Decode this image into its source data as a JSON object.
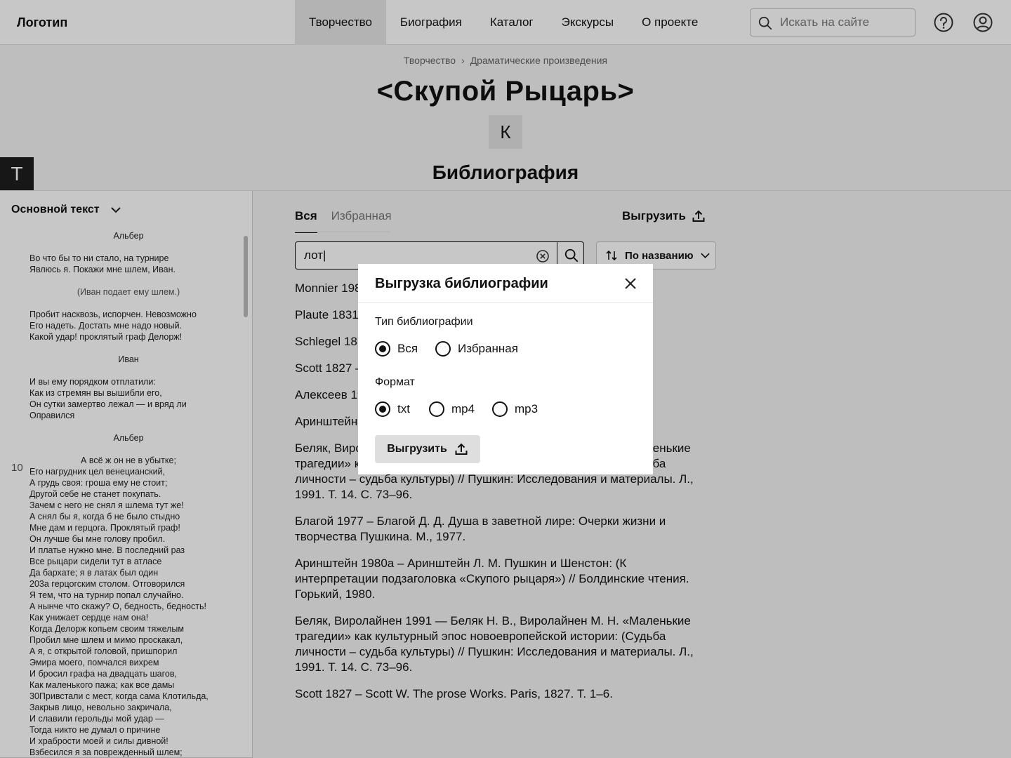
{
  "header": {
    "logo": "Логотип",
    "nav": [
      "Творчество",
      "Биография",
      "Каталог",
      "Экскурсы",
      "О проекте"
    ],
    "active_nav": "Творчество",
    "search_placeholder": "Искать на сайте"
  },
  "breadcrumb": [
    "Творчество",
    "Драматические произведения"
  ],
  "page_title": "<Скупой Рыцарь>",
  "letter_button": "К",
  "text_button": "Т",
  "section_title": "Библиография",
  "text_panel": {
    "title": "Основной текст",
    "line_number": "10",
    "blocks": [
      {
        "type": "speaker",
        "text": "Альбер"
      },
      {
        "type": "verse",
        "lines": [
          "Во что бы то ни стало, на турнире",
          "Явлюсь я. Покажи мне шлем, Иван."
        ]
      },
      {
        "type": "stage",
        "text": "(Иван подает ему шлем.)"
      },
      {
        "type": "verse",
        "lines": [
          "Пробит насквозь, испорчен. Невозможно",
          "Его надеть. Достать мне надо новый.",
          "Какой удар! проклятый граф Делорж!"
        ]
      },
      {
        "type": "speaker",
        "text": "Иван"
      },
      {
        "type": "verse",
        "lines": [
          "И вы ему порядком отплатили:",
          "Как из стремян вы вышибли его,",
          "Он сутки замертво лежал — и вряд ли",
          "Оправился"
        ]
      },
      {
        "type": "speaker",
        "text": "Альбер"
      },
      {
        "type": "verse_first_centered",
        "first": "А всё ж он не в убытке;",
        "lines": [
          "Его нагрудник цел венецианский,",
          "А грудь своя: гроша ему не стоит;",
          "Другой себе не станет покупать.",
          "Зачем с него не снял я шлема тут же!",
          "А снял бы я, когда б не было стыдно",
          "Мне дам и герцога. Проклятый граф!",
          "Он лучше бы мне голову пробил.",
          "И платье нужно мне. В последний раз",
          "Все рыцари сидели тут в атласе",
          "Да бархате; я в латах был один",
          "203а герцогским столом. Отговорился",
          "Я тем, что на турнир попал случайно.",
          "А нынче что скажу? О, бедность, бедность!",
          "Как унижает сердце нам она!",
          "Когда Делорж копьем своим тяжелым",
          "Пробил мне шлем и мимо проскакал,",
          "А я, с открытой головой, пришпорил",
          "Эмира моего, помчался вихрем",
          "И бросил графа на двадцать шагов,",
          "Как маленького пажа; как все дамы",
          "30Привстали с мест, когда сама Клотильда,",
          "Закрыв лицо, невольно закричала,",
          "И славили герольды мой удар —",
          "Тогда никто не думал о причине",
          "И храбрости моей и силы дивной!",
          "Взбесился я за поврежденный шлем;"
        ]
      }
    ]
  },
  "bibliography": {
    "tabs": [
      "Вся",
      "Избранная"
    ],
    "active_tab": "Вся",
    "export_label": "Выгрузить",
    "search_value": "лот|",
    "sort_label": "По названию",
    "entries": [
      "Monnier 198… Revue des Etudes Slav…",
      "Plaute 1831…",
      "Schlegel 18… Paris, 1814. Т. 1–3..",
      "Scott 1827 –…",
      "Алексеев 19…",
      "Аринштейн … интерпрета… Болдинские чтения. Горький, 1980.",
      "Беляк, Виролайнен 1991  — Беляк Н. В., Виролайнен М. Н. «Маленькие трагедии» как культурный эпос новоевропейской истории: (Судьба личности – судьба культуры) // Пушкин: Исследования и материалы. Л., 1991. Т. 14. С. 73–96.",
      "Благой  1977 – Благой Д. Д. Душа в заветной лире: Очерки жизни и творчества Пушкина. М., 1977.",
      "Аринштейн  1980а – Аринштейн Л. М. Пушкин и Шенстон: (К интерпретации подзаголовка «Скупого рыцаря») // Болдинские чтения. Горький, 1980.",
      "Беляк, Виролайнен 1991  — Беляк Н. В., Виролайнен М. Н. «Маленькие трагедии» как культурный эпос новоевропейской истории: (Судьба личности – судьба культуры) // Пушкин: Исследования и материалы. Л., 1991. Т. 14. С. 73–96.",
      "Scott 1827 – Scott W. The prose Works. Paris, 1827. Т. 1–6."
    ]
  },
  "modal": {
    "title": "Выгрузка библиографии",
    "type_label": "Тип библиографии",
    "type_options": [
      "Вся",
      "Избранная"
    ],
    "type_selected": "Вся",
    "format_label": "Формат",
    "format_options": [
      "txt",
      "mp4",
      "mp3"
    ],
    "format_selected": "txt",
    "submit_label": "Выгрузить"
  },
  "icons": {
    "search": "search-icon",
    "help": "help-icon",
    "user": "user-icon",
    "close": "close-icon",
    "upload": "upload-icon",
    "sort": "sort-icon",
    "clear": "clear-icon",
    "chevron": "chevron-down-icon"
  },
  "colors": {
    "overlay": "#000000",
    "nav_active": "#e6e6e6",
    "dark_button": "#1e1e1e"
  }
}
